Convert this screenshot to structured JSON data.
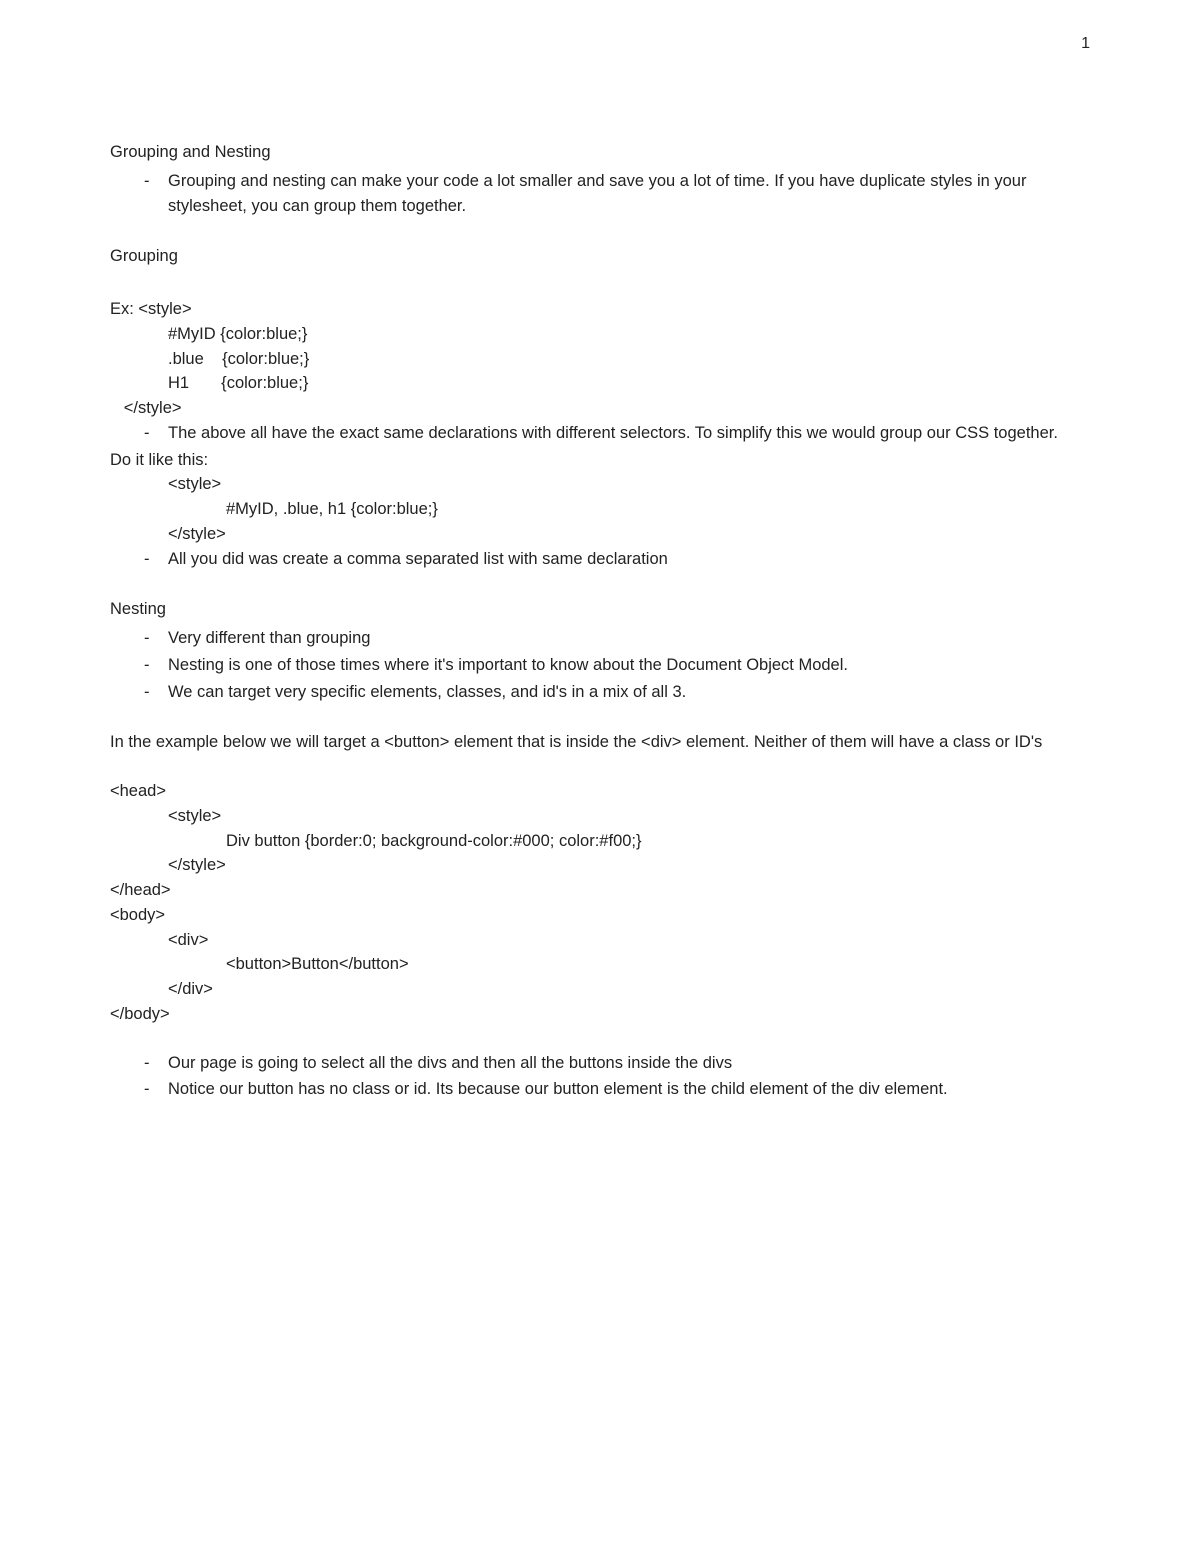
{
  "page_number": "1",
  "title1": "Grouping and Nesting",
  "bullet1": "Grouping and nesting can make your code a lot smaller and save you a lot of time. If you have duplicate styles in your stylesheet, you can group them together.",
  "grouping_heading": "Grouping",
  "ex_label": "Ex: <style>",
  "ex_line1": "#MyID {color:blue;}",
  "ex_line2": ".blue    {color:blue;}",
  "ex_line3": "H1       {color:blue;}",
  "ex_close": "   </style>",
  "bullet2": "The above all have the exact same declarations with different selectors. To simplify this we would group our CSS together.",
  "do_it": "Do it like this:",
  "do_line1": "<style>",
  "do_line2": "#MyID, .blue, h1 {color:blue;}",
  "do_line3": "</style>",
  "bullet3": "All you did was create a comma separated list with same declaration",
  "nesting_heading": "Nesting",
  "nesting_b1": "Very different than grouping",
  "nesting_b2": "Nesting is one of those times where it's important to know about the Document Object Model.",
  "nesting_b3": "We can target very specific elements, classes, and id's in a mix of all 3.",
  "example_intro": "In the example below we will target a <button> element that is inside the <div> element. Neither of them will have a class or ID's",
  "code_head_open": "<head>",
  "code_style_open": "<style>",
  "code_rule": "Div button {border:0; background-color:#000; color:#f00;}",
  "code_style_close": "</style>",
  "code_head_close": "</head>",
  "code_body_open": "<body>",
  "code_div_open": "<div>",
  "code_button": "<button>Button</button>",
  "code_div_close": "</div>",
  "code_body_close": "</body>",
  "final_b1": "Our page is going to select all the divs and then all the buttons inside the divs",
  "final_b2": "Notice our button has no class or id. Its because our button element is the child element of the div element."
}
